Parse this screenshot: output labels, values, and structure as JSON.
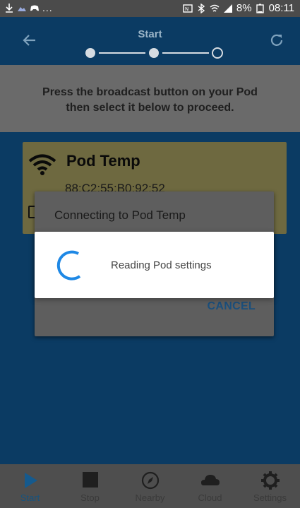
{
  "status_bar": {
    "left_dots": "...",
    "battery": "8%",
    "time": "08:11",
    "icons": [
      "download-icon",
      "photo-icon",
      "gamepad-icon",
      "nfc-icon",
      "bluetooth-icon",
      "wifi-icon",
      "signal-icon",
      "battery-icon"
    ]
  },
  "app_bar": {
    "title": "Start",
    "back_icon": "arrow-left-icon",
    "refresh_icon": "refresh-icon",
    "steps_total": 3,
    "current_step": 2
  },
  "instruction": {
    "line1": "Press the broadcast button on your Pod",
    "line2": "then select it below to proceed."
  },
  "pod": {
    "name": "Pod Temp",
    "mac": "88:C2:55:B0:92:52"
  },
  "dialog": {
    "title": "Connecting to Pod Temp",
    "cancel_label": "CANCEL"
  },
  "progress": {
    "text": "Reading Pod settings"
  },
  "nav": {
    "items": [
      {
        "label": "Start",
        "icon": "play-icon",
        "active": true
      },
      {
        "label": "Stop",
        "icon": "stop-icon",
        "active": false
      },
      {
        "label": "Nearby",
        "icon": "compass-icon",
        "active": false
      },
      {
        "label": "Cloud",
        "icon": "cloud-icon",
        "active": false
      },
      {
        "label": "Settings",
        "icon": "gear-icon",
        "active": false
      }
    ]
  },
  "colors": {
    "accent": "#1e88e5",
    "app_bar": "#1a70b5",
    "cancel": "#1b4f7c"
  }
}
